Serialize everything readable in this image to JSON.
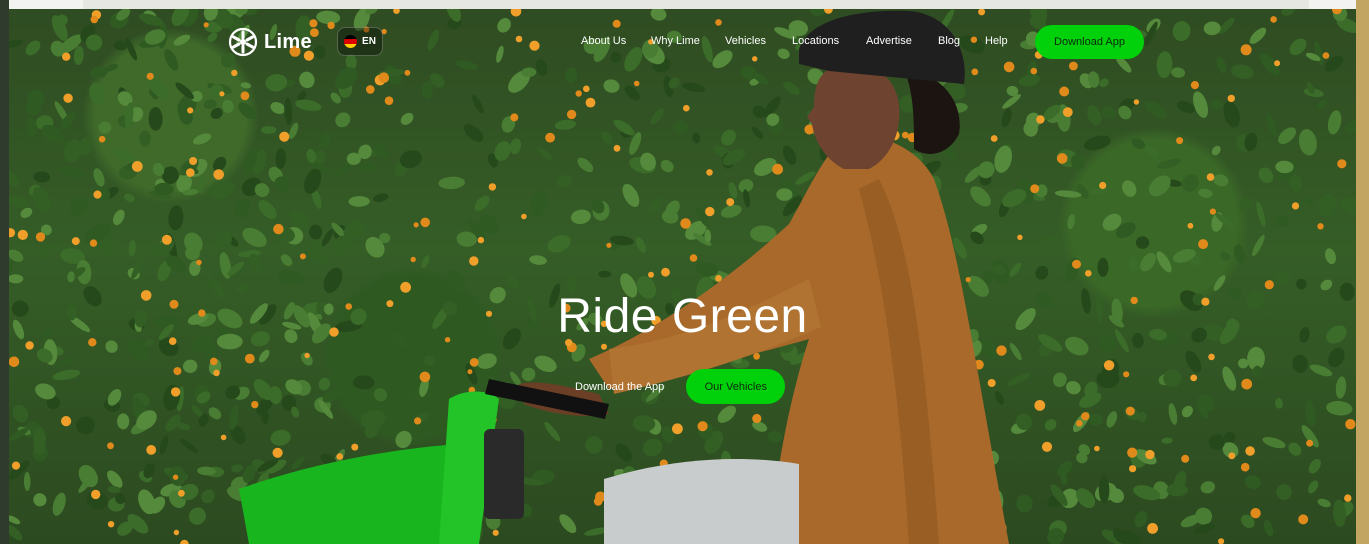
{
  "nav": {
    "logo_text": "Lime",
    "language": "EN",
    "menu": [
      {
        "label": "About Us"
      },
      {
        "label": "Why Lime"
      },
      {
        "label": "Vehicles"
      },
      {
        "label": "Locations"
      },
      {
        "label": "Advertise"
      },
      {
        "label": "Blog"
      },
      {
        "label": "Help"
      }
    ],
    "cta_label": "Download App"
  },
  "hero": {
    "title": "Ride Green",
    "secondary_action": "Download the App",
    "primary_action": "Our Vehicles"
  },
  "colors": {
    "brand_green": "#00d10b",
    "text": "#ffffff"
  },
  "icons": {
    "logo": "lime-wheel-icon",
    "flag": "germany-flag-icon"
  }
}
